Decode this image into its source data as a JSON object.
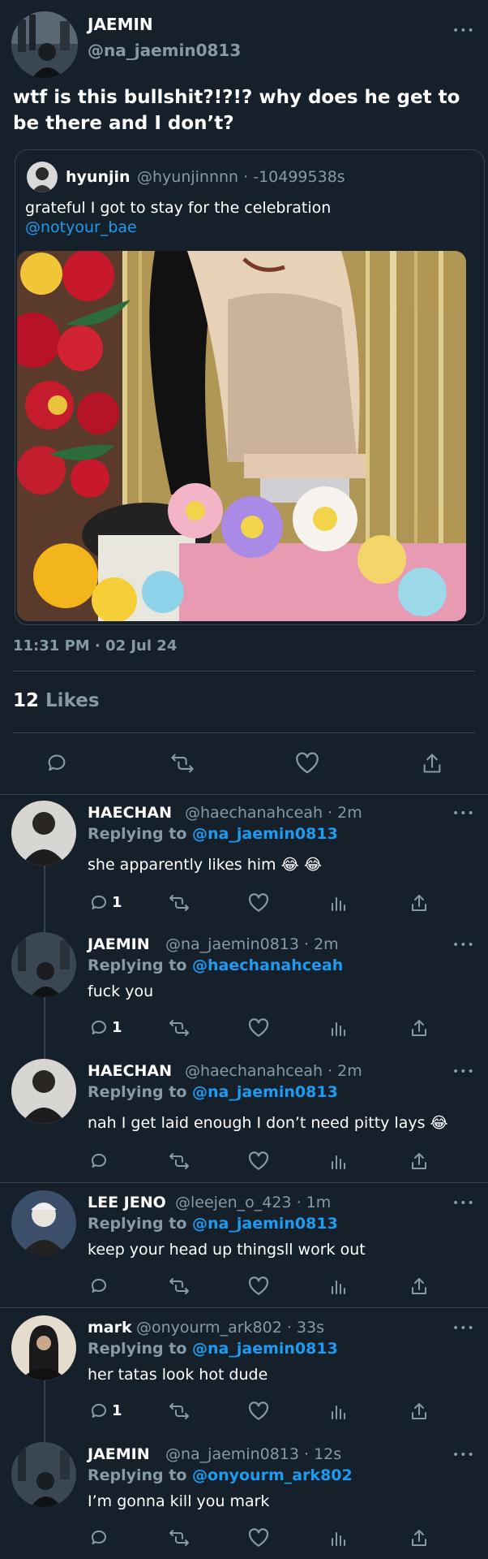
{
  "main_tweet": {
    "name": "JAEMIN",
    "handle": "@na_jaemin0813",
    "text": "wtf is this bullshit?!?!? why does he get to be there and I don’t?",
    "timestamp": "11:31 PM · 02 Jul 24",
    "likes_count": "12",
    "likes_label": "Likes"
  },
  "quoted": {
    "name": "hyunjin",
    "meta": "@hyunjinnnn · -10499538s",
    "text": "grateful I got to stay for the celebration",
    "mention": "@notyour_bae"
  },
  "replies": [
    {
      "name": "HAECHAN",
      "meta": "@haechanahceah · 2m",
      "replying_label": "Replying to",
      "replying_to": "@na_jaemin0813",
      "text": "she apparently likes him 😂 😂",
      "reply_count": "1"
    },
    {
      "name": "JAEMIN",
      "meta": "@na_jaemin0813 · 2m",
      "replying_label": "Replying to",
      "replying_to": "@haechanahceah",
      "text": "fuck you",
      "reply_count": "1"
    },
    {
      "name": "HAECHAN",
      "meta": "@haechanahceah · 2m",
      "replying_label": "Replying to",
      "replying_to": "@na_jaemin0813",
      "text": "nah I get laid enough I don’t need pitty lays 😂",
      "reply_count": ""
    },
    {
      "name": "LEE JENO",
      "meta": "@leejen_o_423 · 1m",
      "replying_label": "Replying to",
      "replying_to": "@na_jaemin0813",
      "text": "keep your head up thingsll work out",
      "reply_count": ""
    },
    {
      "name": "mark",
      "meta": "@onyourm_ark802 · 33s",
      "replying_label": "Replying to",
      "replying_to": "@na_jaemin0813",
      "text": "her tatas look hot dude",
      "reply_count": "1"
    },
    {
      "name": "JAEMIN",
      "meta": "@na_jaemin0813 · 12s",
      "replying_label": "Replying to",
      "replying_to": "@onyourm_ark802",
      "text": "I’m gonna kill you mark",
      "reply_count": ""
    }
  ],
  "more_label": "•••",
  "colors": {
    "background": "#15202b",
    "accent": "#1d9bf0",
    "muted": "#8899a6",
    "divider": "#38444d"
  }
}
